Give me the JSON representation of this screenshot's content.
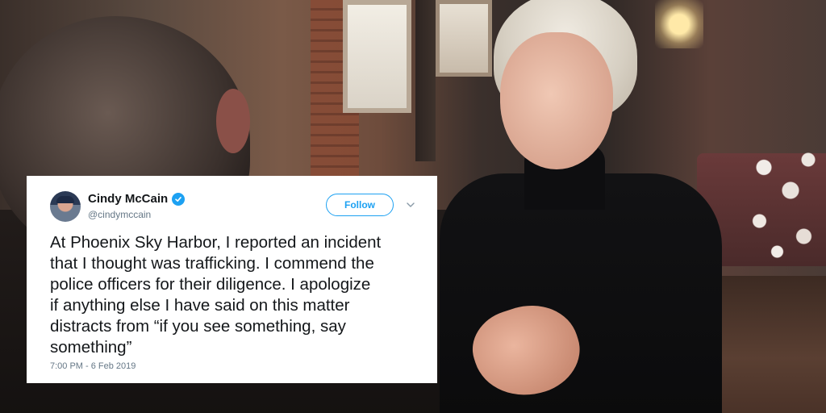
{
  "tweet": {
    "display_name": "Cindy McCain",
    "handle": "@cindymccain",
    "verified": true,
    "follow_label": "Follow",
    "text": "At Phoenix Sky Harbor, I reported an incident\nthat I thought was trafficking. I commend the\npolice officers for their diligence. I apologize\nif anything else I have said on this matter\ndistracts from “if you see something, say\nsomething”",
    "timestamp": "7:00 PM - 6 Feb 2019"
  },
  "icons": {
    "verified": "verified-badge-icon",
    "menu": "chevron-down-icon"
  },
  "colors": {
    "accent": "#1da1f2",
    "text": "#14171a",
    "muted": "#657786",
    "card_bg": "#ffffff"
  }
}
